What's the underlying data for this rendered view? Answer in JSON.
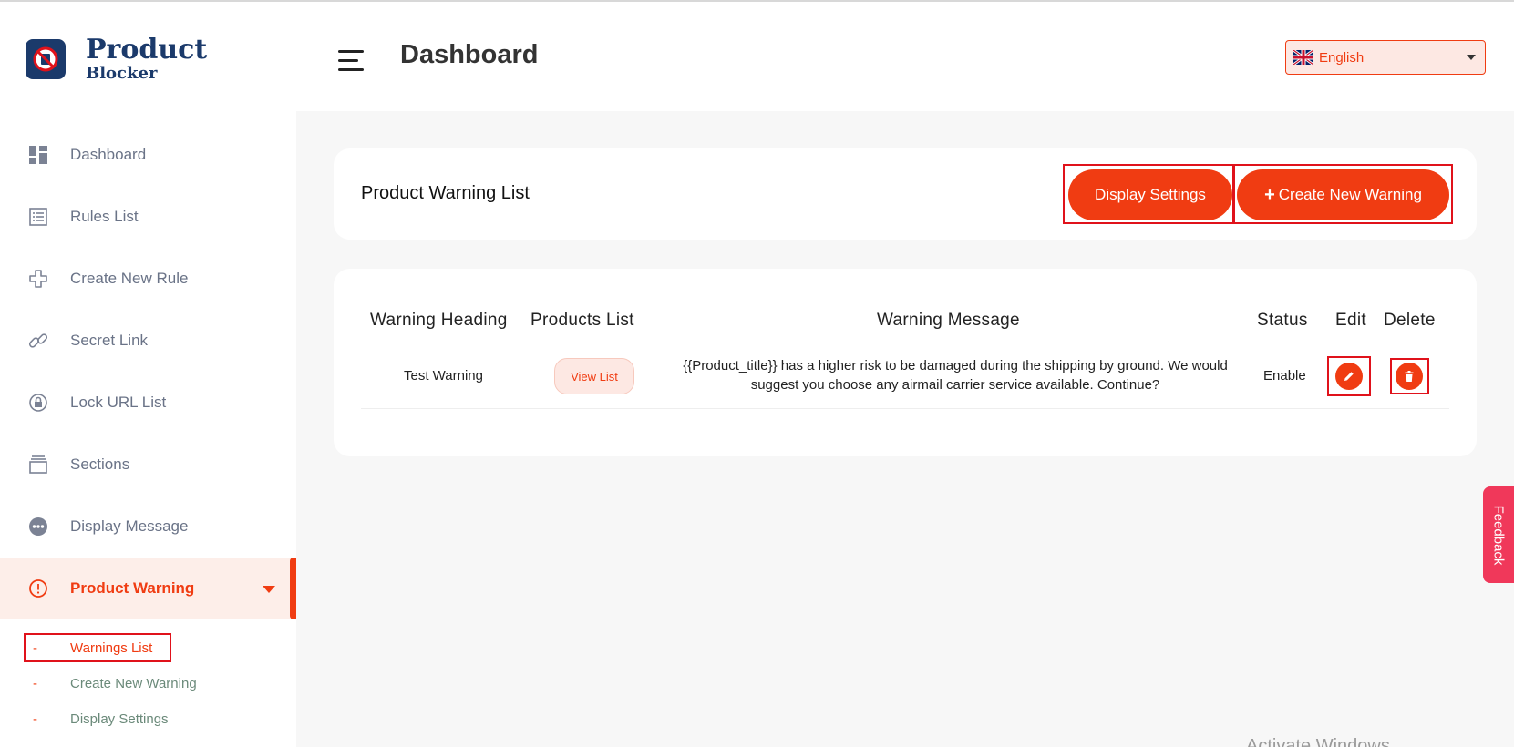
{
  "app": {
    "logo_line1": "Product",
    "logo_line2": "Blocker"
  },
  "sidebar": {
    "items": [
      {
        "label": "Dashboard",
        "icon": "dashboard-grid-icon"
      },
      {
        "label": "Rules List",
        "icon": "list-icon"
      },
      {
        "label": "Create New Rule",
        "icon": "plus-outline-icon"
      },
      {
        "label": "Secret Link",
        "icon": "link-icon"
      },
      {
        "label": "Lock URL List",
        "icon": "lock-icon"
      },
      {
        "label": "Sections",
        "icon": "sections-icon"
      },
      {
        "label": "Display Message",
        "icon": "chat-dots-icon"
      },
      {
        "label": "Product Warning",
        "icon": "warning-circle-icon"
      }
    ],
    "sub_items": [
      {
        "label": "Warnings List"
      },
      {
        "label": "Create New Warning"
      },
      {
        "label": "Display Settings"
      }
    ],
    "dash": "-"
  },
  "header": {
    "title": "Dashboard",
    "language": "English"
  },
  "warning_card": {
    "title": "Product Warning List",
    "display_settings_label": "Display Settings",
    "create_label": "Create New Warning",
    "plus": "+"
  },
  "table": {
    "headers": [
      "Warning Heading",
      "Products List",
      "Warning Message",
      "Status",
      "Edit",
      "Delete"
    ],
    "rows": [
      {
        "heading": "Test Warning",
        "products": "View List",
        "message": "{{Product_title}} has a higher risk to be damaged during the shipping by ground. We would suggest you choose any airmail carrier service available. Continue?",
        "status": "Enable"
      }
    ]
  },
  "feedback": "Feedback",
  "watermark": "Activate Windows",
  "colors": {
    "accent": "#f03c12",
    "highlight": "#e0121b",
    "brand": "#1b3a6b",
    "feedback": "#f0385a"
  }
}
